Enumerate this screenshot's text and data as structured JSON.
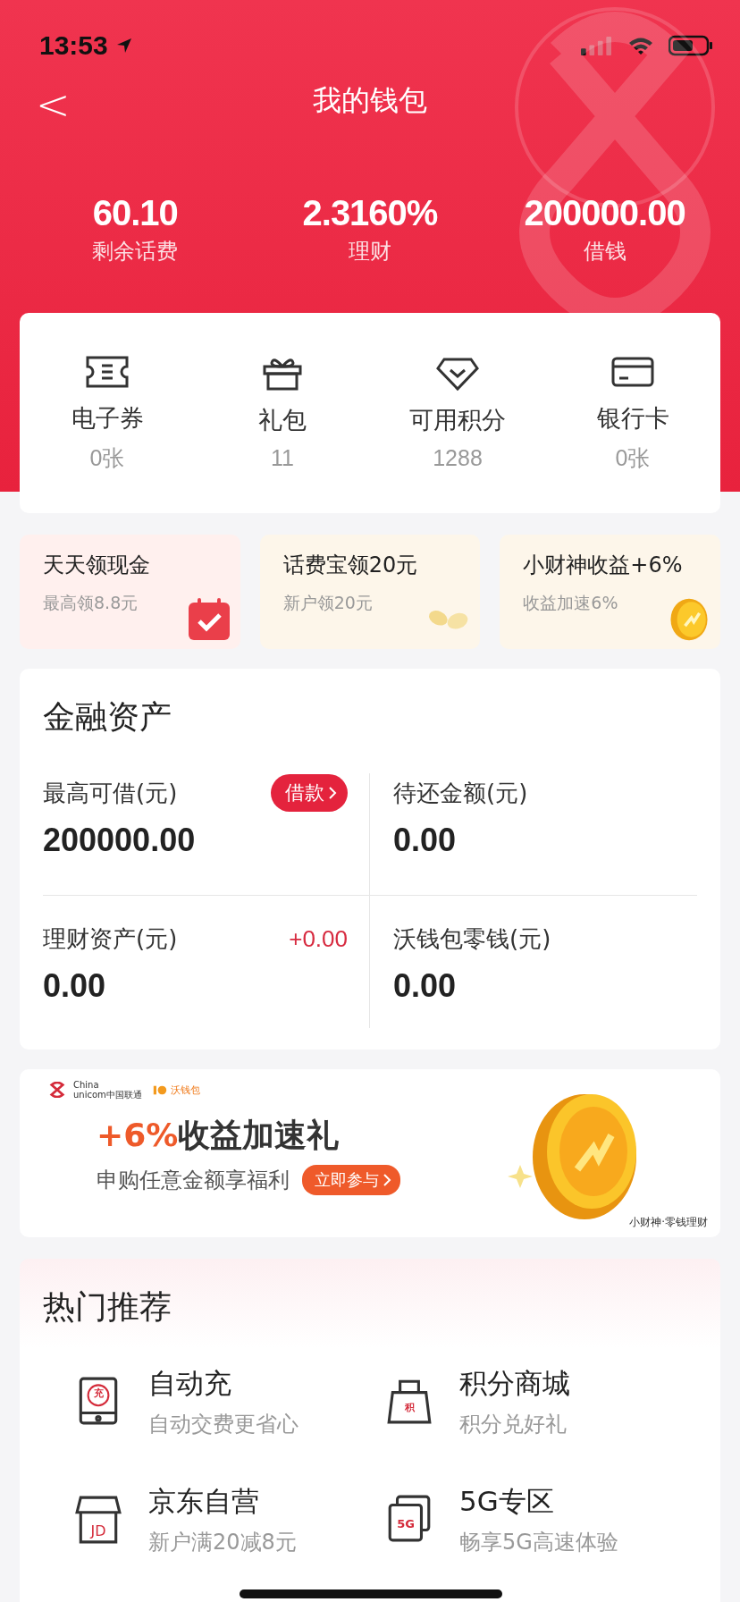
{
  "status_bar": {
    "time": "13:53"
  },
  "nav": {
    "back": "<",
    "title": "我的钱包"
  },
  "stats": [
    {
      "value": "60.10",
      "label": "剩余话费"
    },
    {
      "value": "2.3160%",
      "label": "理财"
    },
    {
      "value": "200000.00",
      "label": "借钱"
    }
  ],
  "quick_actions": [
    {
      "kind": "ticket",
      "label": "电子券",
      "count": "0张"
    },
    {
      "kind": "gift",
      "label": "礼包",
      "count": "11"
    },
    {
      "kind": "diamond",
      "label": "可用积分",
      "count": "1288"
    },
    {
      "kind": "card",
      "label": "银行卡",
      "count": "0张"
    }
  ],
  "promos": [
    {
      "kind": "calendar",
      "title": "天天领现金",
      "subtitle": "最高领8.8元",
      "color": "#fff0ee"
    },
    {
      "kind": "beans",
      "title": "话费宝领20元",
      "subtitle": "新户领20元",
      "color": "#fdf6ea"
    },
    {
      "kind": "coin",
      "title": "小财神收益+6%",
      "subtitle": "收益加速6%",
      "color": "#fdf6ea"
    }
  ],
  "assets": {
    "title": "金融资产",
    "cells": [
      {
        "label": "最高可借(元)",
        "value": "200000.00",
        "action": "借款"
      },
      {
        "label": "待还金额(元)",
        "value": "0.00"
      },
      {
        "label": "理财资产(元)",
        "value": "0.00",
        "change": "+0.00"
      },
      {
        "label": "沃钱包零钱(元)",
        "value": "0.00"
      }
    ]
  },
  "banner": {
    "logo_lines": [
      "China",
      "unicom中国联通"
    ],
    "wallet": "沃钱包",
    "title": "**+6%**收益加速礼",
    "subtitle": "申购任意金额享福利",
    "button": "立即参与",
    "caption": "小财神·零钱理财"
  },
  "hot": {
    "title": "热门推荐",
    "items": [
      {
        "kind": "phone",
        "icon_text": "充",
        "title": "自动充",
        "subtitle": "自动交费更省心"
      },
      {
        "kind": "bag",
        "icon_text": "积",
        "title": "积分商城",
        "subtitle": "积分兑好礼"
      },
      {
        "kind": "shop",
        "icon_text": "JD",
        "title": "京东自营",
        "subtitle": "新户满20减8元"
      },
      {
        "kind": "cards",
        "icon_text": "5G",
        "title": "5G专区",
        "subtitle": "畅享5G高速体验"
      }
    ]
  }
}
